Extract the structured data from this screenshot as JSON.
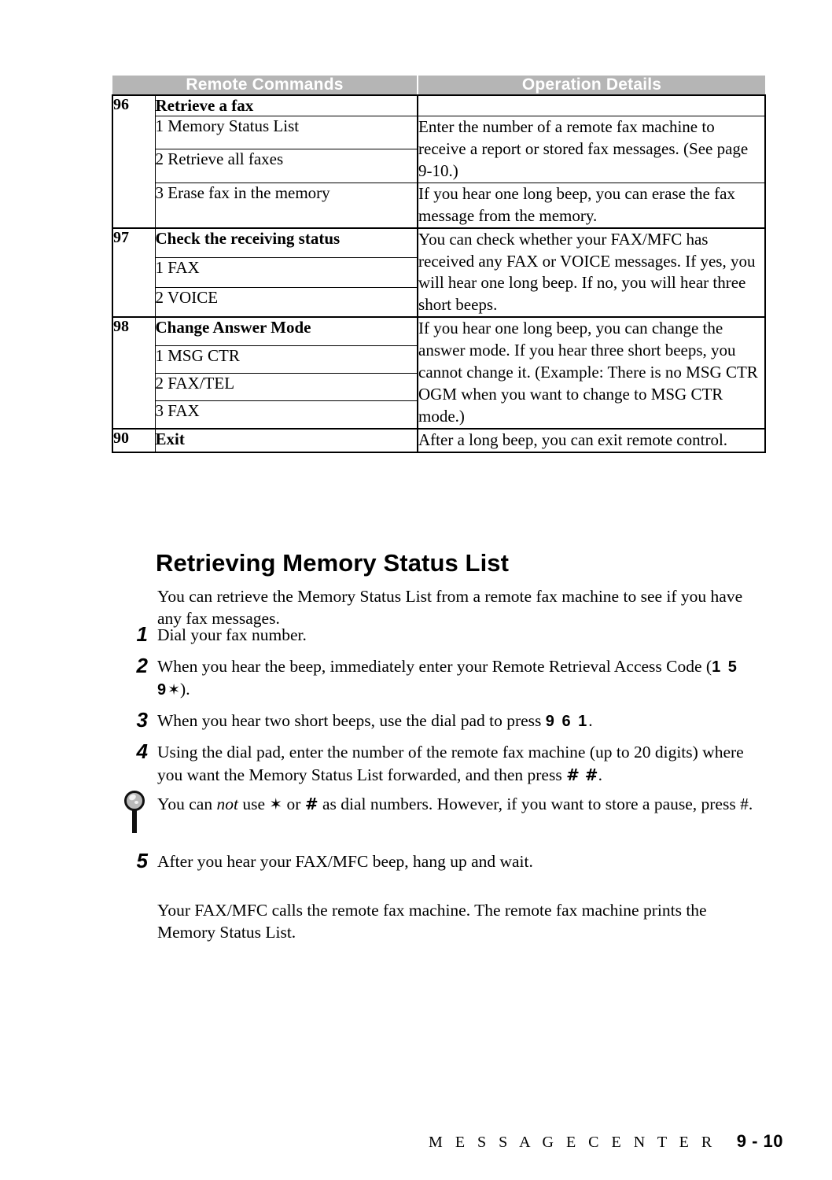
{
  "document": {
    "page_label": "9 - 10",
    "footer_title": "M E S S A G E   C E N T E R"
  },
  "table": {
    "headers": {
      "commands": "Remote Commands",
      "details": "Operation Details"
    },
    "header_bg": "#b5b5b5",
    "header_fg": "#ffffff",
    "groups": [
      {
        "code": "96",
        "title": "Retrieve a fax",
        "title_detail": "",
        "subrows": [
          {
            "label": "1 Memory Status List"
          },
          {
            "label": "2 Retrieve all faxes"
          },
          {
            "label": "3 Erase fax in the memory"
          }
        ],
        "detail_1": "Enter the number of a remote fax machine to receive a report or stored fax messages. (See page 9-10.)",
        "detail_2": "If you hear one long beep, you can erase the fax message from the memory."
      },
      {
        "code": "97",
        "title": "Check the receiving status",
        "subrows": [
          {
            "label": "1 FAX"
          },
          {
            "label": "2 VOICE"
          }
        ],
        "detail_1": "You can check whether your FAX/MFC has received any FAX or VOICE messages. If yes, you will hear one long beep. If no, you will hear three short beeps."
      },
      {
        "code": "98",
        "title": "Change Answer Mode",
        "subrows": [
          {
            "label": "1 MSG CTR"
          },
          {
            "label": "2 FAX/TEL"
          },
          {
            "label": "3 FAX"
          }
        ],
        "detail_1": "If you hear one long beep, you can change the answer mode. If you hear three short beeps, you cannot change it. (Example: There is no MSG CTR OGM when you want to change to MSG CTR mode.)"
      },
      {
        "code": "90",
        "title": "Exit",
        "subrows": [],
        "detail_1": "After a long beep, you can exit remote control."
      }
    ]
  },
  "section": {
    "heading": "Retrieving Memory Status List",
    "intro": "You can retrieve the Memory Status List from a remote fax machine to see if you have any fax messages.",
    "steps": [
      {
        "number": "1",
        "text": "Dial your fax number."
      },
      {
        "number": "2",
        "text_before": "When you hear the beep, immediately enter your Remote Retrieval Access Code (",
        "code": "1 5 9",
        "code_symbol": "✶",
        "text_after": ")."
      },
      {
        "number": "3",
        "text_before": "When you hear two short beeps, use the dial pad to press ",
        "code": "9 6 1",
        "text_after": "."
      },
      {
        "number": "4",
        "text_before": "Using the dial pad, enter the number of the remote fax machine (up to 20 digits) where you want the Memory Status List forwarded, and then press ",
        "code": "# #",
        "text_after": "."
      },
      {
        "number": "5",
        "text": "After you hear your FAX/MFC beep, hang up and wait."
      }
    ],
    "note": {
      "icon": "note-bulb-icon",
      "part_1": "You can ",
      "emphasis": "not",
      "part_2": " use ",
      "symbol_star": "✶",
      "part_3": " or ",
      "symbol_hash": "#",
      "part_4": " as dial numbers.  However, if you want to store a pause, press #."
    },
    "closing": "Your FAX/MFC calls the remote fax machine.  The remote fax machine prints the Memory Status List."
  }
}
